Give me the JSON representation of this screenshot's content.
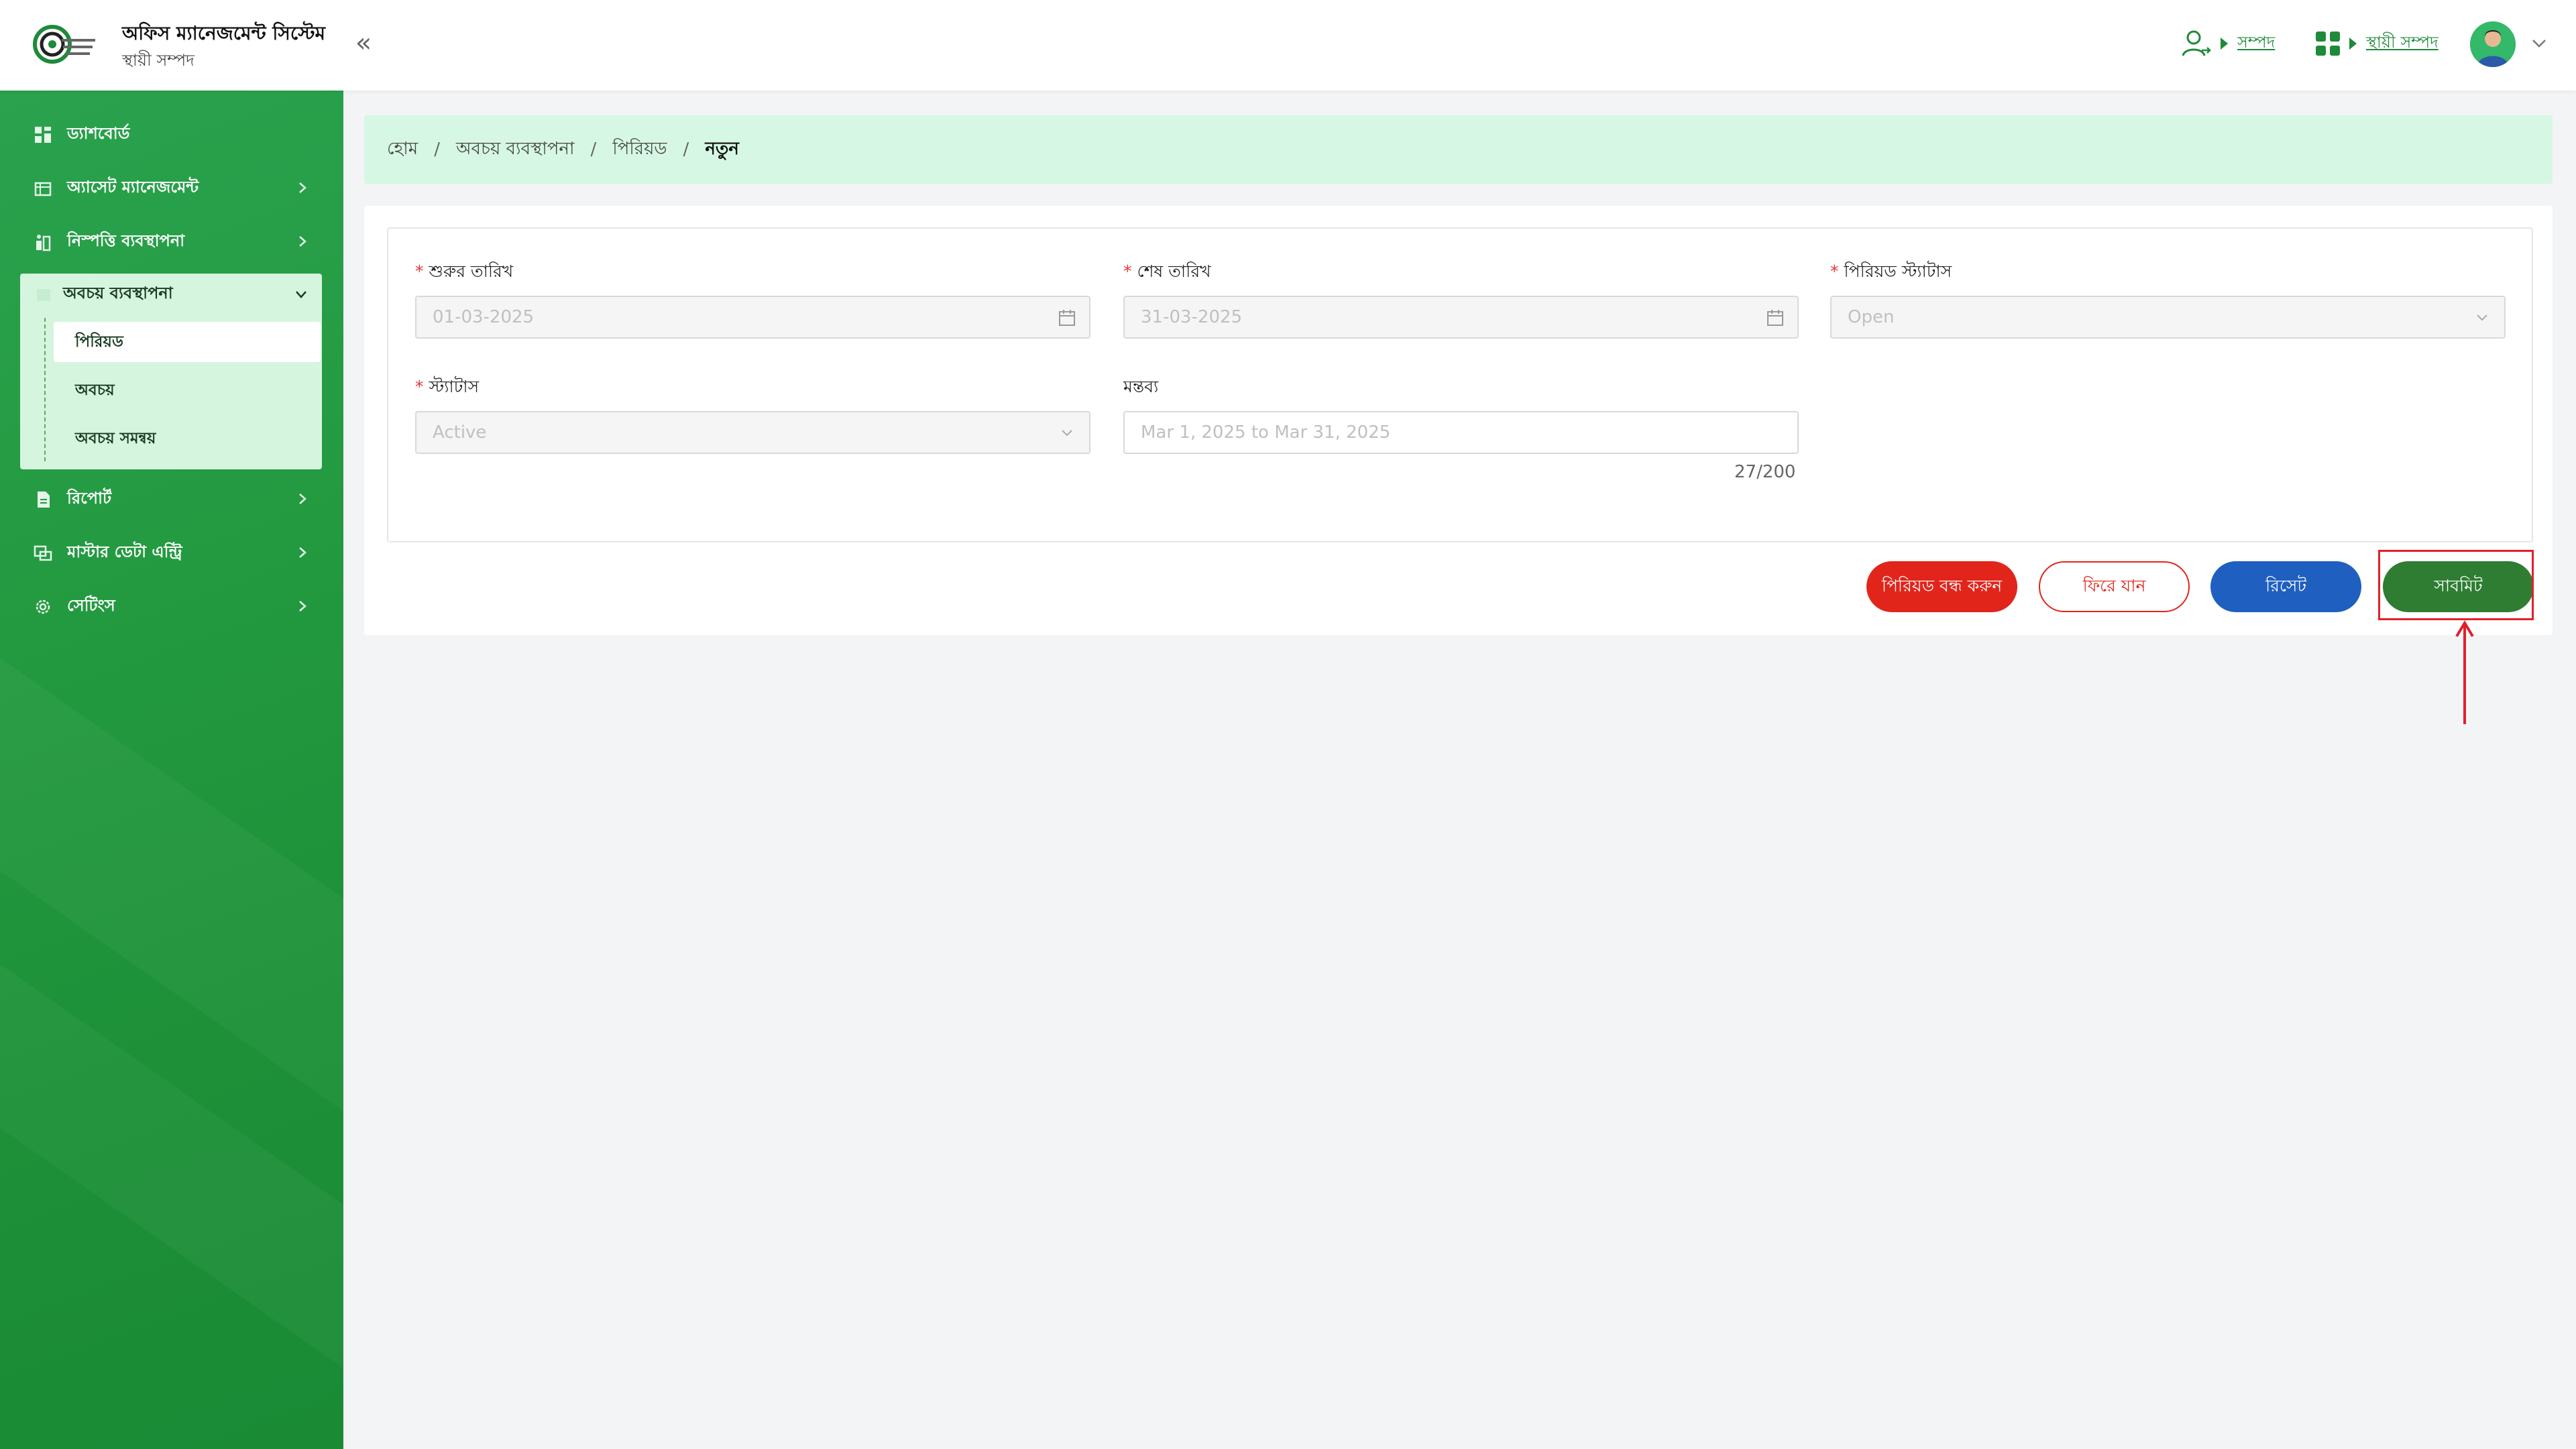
{
  "header": {
    "app_title": "অফিস ম্যানেজমেন্ট সিস্টেম",
    "app_subtitle": "স্থায়ী সম্পদ",
    "role_link": "সম্পদ",
    "module_link": "স্থায়ী সম্পদ"
  },
  "sidebar": {
    "items": [
      {
        "label": "ড্যাশবোর্ড"
      },
      {
        "label": "অ্যাসেট ম্যানেজমেন্ট"
      },
      {
        "label": "নিস্পত্তি ব্যবস্থাপনা"
      },
      {
        "label": "অবচয় ব্যবস্থাপনা"
      },
      {
        "label": "রিপোর্ট"
      },
      {
        "label": "মাস্টার ডেটা এন্ট্রি"
      },
      {
        "label": "সেটিংস"
      }
    ],
    "sub_items": [
      {
        "label": "পিরিয়ড"
      },
      {
        "label": "অবচয়"
      },
      {
        "label": "অবচয় সমন্বয়"
      }
    ]
  },
  "breadcrumb": {
    "home": "হোম",
    "section": "অবচয় ব্যবস্থাপনা",
    "page": "পিরিয়ড",
    "current": "নতুন"
  },
  "form": {
    "start_date_label": "শুরুর তারিখ",
    "start_date_value": "01-03-2025",
    "end_date_label": "শেষ তারিখ",
    "end_date_value": "31-03-2025",
    "period_status_label": "পিরিয়ড স্ট্যাটাস",
    "period_status_value": "Open",
    "status_label": "স্ট্যাটাস",
    "status_value": "Active",
    "remark_label": "মন্তব্য",
    "remark_value": "Mar 1, 2025 to Mar 31, 2025",
    "remark_counter": "27/200",
    "required_mark": "*"
  },
  "buttons": {
    "close_period": "পিরিয়ড বন্ধ করুন",
    "back": "ফিরে যান",
    "reset": "রিসেট",
    "submit": "সাবমিট"
  },
  "colors": {
    "sidebar_green": "#23993f",
    "accent_green": "#1e8a3a",
    "danger_red": "#e1251b",
    "primary_blue": "#1f5fbf",
    "submit_green": "#2e7d32",
    "breadcrumb_bg": "#d6f7e3"
  }
}
